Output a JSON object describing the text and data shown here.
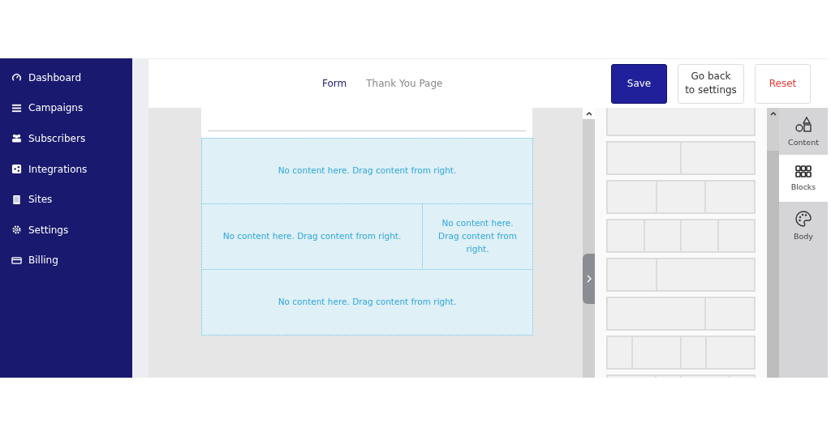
{
  "sidebar": {
    "items": [
      {
        "label": "Dashboard"
      },
      {
        "label": "Campaigns"
      },
      {
        "label": "Subscribers"
      },
      {
        "label": "Integrations"
      },
      {
        "label": "Sites"
      },
      {
        "label": "Settings"
      },
      {
        "label": "Billing"
      }
    ]
  },
  "header": {
    "tabs": [
      {
        "label": "Form",
        "selected": true
      },
      {
        "label": "Thank You Page",
        "selected": false
      }
    ],
    "buttons": [
      {
        "label": "Save",
        "kind": "primary"
      },
      {
        "label": "Go back\nto settings",
        "kind": "default"
      },
      {
        "label": "Reset",
        "kind": "danger"
      }
    ]
  },
  "canvas": {
    "rows": [
      {
        "cells": [
          {
            "text": "No content here. Drag content from right."
          }
        ]
      },
      {
        "cells": [
          {
            "text": "No content here. Drag content from right."
          },
          {
            "text": "No content here. Drag content from right."
          }
        ]
      },
      {
        "cells": [
          {
            "text": "No content here. Drag content from right."
          }
        ]
      }
    ]
  },
  "blocks_panel": {
    "blocks": [
      {
        "kind": "one"
      },
      {
        "kind": "two"
      },
      {
        "kind": "three"
      },
      {
        "kind": "four"
      },
      {
        "kind": "third-twothirds"
      },
      {
        "kind": "twothirds-third"
      },
      {
        "kind": "alt-small-wide"
      },
      {
        "kind": "alt-wide-small"
      }
    ]
  },
  "side_tabs": [
    {
      "label": "Content",
      "selected": false
    },
    {
      "label": "Blocks",
      "selected": true
    },
    {
      "label": "Body",
      "selected": false
    }
  ]
}
